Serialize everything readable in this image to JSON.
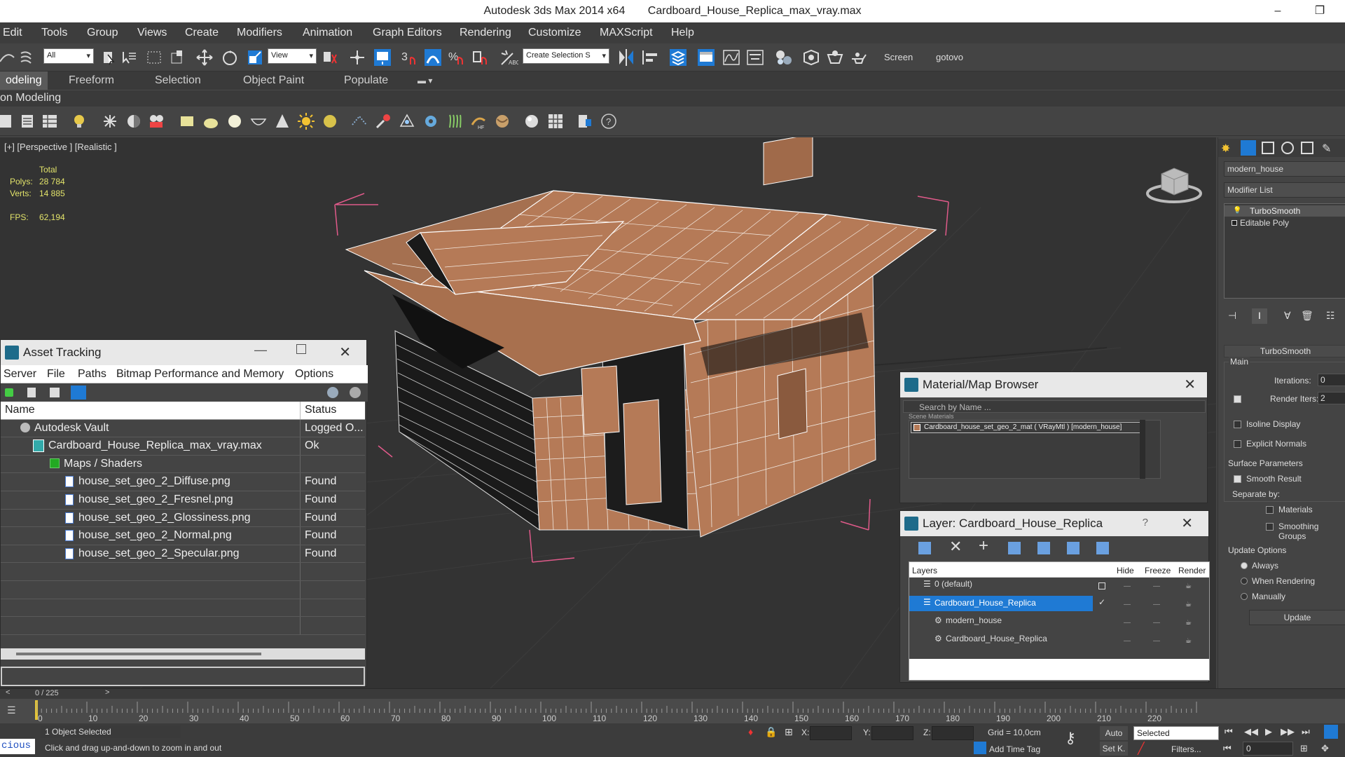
{
  "window": {
    "app_title": "Autodesk 3ds Max  2014 x64",
    "file_title": "Cardboard_House_Replica_max_vray.max",
    "minimize_glyph": "–",
    "restore_glyph": "❐"
  },
  "menubar": [
    "Edit",
    "Tools",
    "Group",
    "Views",
    "Create",
    "Modifiers",
    "Animation",
    "Graph Editors",
    "Rendering",
    "Customize",
    "MAXScript",
    "Help"
  ],
  "toolbar": {
    "filter_value": "All",
    "refcoord_value": "View",
    "selection_set_placeholder": "Create Selection S",
    "snap_label": "3",
    "screen_label": "Screen",
    "gotovo_label": "gotovo"
  },
  "ribbon": {
    "tabs": [
      "odeling",
      "Freeform",
      "Selection",
      "Object Paint",
      "Populate"
    ],
    "subtitle": "on Modeling"
  },
  "viewport": {
    "label": "[+] [Perspective ] [Realistic ]",
    "stats_total": "Total",
    "polys_label": "Polys:",
    "polys_value": "28 784",
    "verts_label": "Verts:",
    "verts_value": "14 885",
    "fps_label": "FPS:",
    "fps_value": "62,194"
  },
  "asset_tracking": {
    "title": "Asset Tracking",
    "menu": [
      "Server",
      "File",
      "Paths",
      "Bitmap Performance and Memory",
      "Options"
    ],
    "col_name": "Name",
    "col_status": "Status",
    "rows": [
      {
        "name": "Autodesk Vault",
        "status": "Logged O..."
      },
      {
        "name": "Cardboard_House_Replica_max_vray.max",
        "status": "Ok"
      },
      {
        "name": "Maps / Shaders",
        "status": ""
      },
      {
        "name": "house_set_geo_2_Diffuse.png",
        "status": "Found"
      },
      {
        "name": "house_set_geo_2_Fresnel.png",
        "status": "Found"
      },
      {
        "name": "house_set_geo_2_Glossiness.png",
        "status": "Found"
      },
      {
        "name": "house_set_geo_2_Normal.png",
        "status": "Found"
      },
      {
        "name": "house_set_geo_2_Specular.png",
        "status": "Found"
      }
    ],
    "frame_counter": "0 / 225"
  },
  "material_browser": {
    "title": "Material/Map Browser",
    "search_placeholder": "Search by Name ...",
    "section": "Scene Materials",
    "item": "Cardboard_house_set_geo_2_mat ( VRayMtl ) [modern_house]"
  },
  "layer_panel": {
    "title": "Layer: Cardboard_House_Replica",
    "help_glyph": "?",
    "col_layers": "Layers",
    "col_hide": "Hide",
    "col_freeze": "Freeze",
    "col_render": "Render",
    "rows": [
      {
        "name": "0 (default)"
      },
      {
        "name": "Cardboard_House_Replica"
      },
      {
        "name": "modern_house"
      },
      {
        "name": "Cardboard_House_Replica"
      }
    ]
  },
  "command_panel": {
    "object_name": "modern_house",
    "modifier_list": "Modifier List",
    "stack": [
      "TurboSmooth",
      "Editable Poly"
    ],
    "rollout_title": "TurboSmooth",
    "main_label": "Main",
    "iterations_label": "Iterations:",
    "iterations_value": "0",
    "render_iters_label": "Render Iters:",
    "render_iters_value": "2",
    "isoline_label": "Isoline Display",
    "explicit_label": "Explicit Normals",
    "surface_label": "Surface Parameters",
    "smooth_label": "Smooth Result",
    "separate_label": "Separate by:",
    "materials_label": "Materials",
    "smoothing_label": "Smoothing Groups",
    "update_options_label": "Update Options",
    "always_label": "Always",
    "when_rendering_label": "When Rendering",
    "manually_label": "Manually",
    "update_button": "Update"
  },
  "timeline": {
    "ticks": [
      "0",
      "10",
      "20",
      "30",
      "40",
      "50",
      "60",
      "70",
      "80",
      "90",
      "100",
      "110",
      "120",
      "130",
      "140",
      "150",
      "160",
      "170",
      "180",
      "190",
      "200",
      "210",
      "220"
    ]
  },
  "statusbar": {
    "selected_text": "1 Object Selected",
    "prompt_text": "Click and drag up-and-down to zoom in and out",
    "maxscript_text": "cious",
    "x_label": "X:",
    "y_label": "Y:",
    "z_label": "Z:",
    "grid_text": "Grid = 10,0cm",
    "auto_label": "Auto",
    "selected_dropdown": "Selected",
    "setk_label": "Set K.",
    "filters_label": "Filters...",
    "add_time_tag": "Add Time Tag",
    "frame_value": "0"
  },
  "colors": {
    "accent_blue": "#1f7ad4",
    "stats_yellow": "#e2e36a",
    "house_brown": "#b57a57",
    "viewport_bg": "#333333"
  }
}
